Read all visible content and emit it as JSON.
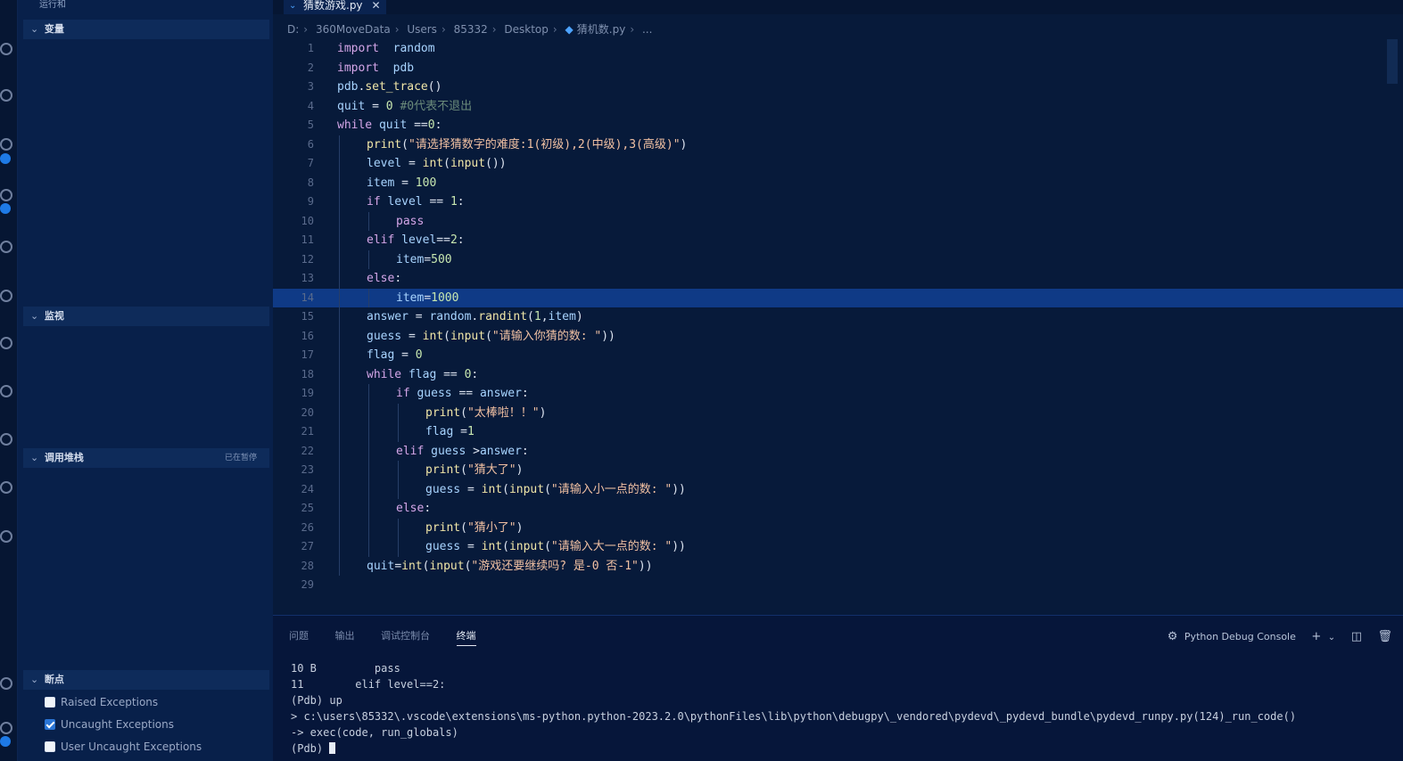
{
  "sidebar": {
    "top_label": "运行和",
    "sections": [
      {
        "title": "变量",
        "aux": ""
      },
      {
        "title": "监视",
        "aux": ""
      },
      {
        "title": "调用堆栈",
        "aux": "已在暂停"
      },
      {
        "title": "断点",
        "aux": ""
      }
    ],
    "exceptions": [
      {
        "label": "Raised Exceptions",
        "checked": false
      },
      {
        "label": "Uncaught Exceptions",
        "checked": true
      },
      {
        "label": "User Uncaught Exceptions",
        "checked": false
      }
    ]
  },
  "editor": {
    "tab_label": "猜数游戏.py",
    "breadcrumb": [
      "D:",
      "360MoveData",
      "Users",
      "85332",
      "Desktop",
      "猜机数.py",
      "..."
    ],
    "highlight_line": 14,
    "lines": [
      {
        "n": "1",
        "indent": 0,
        "tokens": [
          [
            "kw",
            "import"
          ],
          [
            "",
            "  "
          ],
          [
            "var",
            "random"
          ]
        ]
      },
      {
        "n": "2",
        "indent": 0,
        "tokens": [
          [
            "kw",
            "import"
          ],
          [
            "",
            "  "
          ],
          [
            "var",
            "pdb"
          ]
        ]
      },
      {
        "n": "3",
        "indent": 0,
        "tokens": [
          [
            "var",
            "pdb"
          ],
          [
            "",
            "."
          ],
          [
            "fn",
            "set_trace"
          ],
          [
            "",
            "()"
          ]
        ]
      },
      {
        "n": "4",
        "indent": 0,
        "tokens": [
          [
            "var",
            "quit"
          ],
          [
            "",
            " = "
          ],
          [
            "num",
            "0"
          ],
          [
            "",
            " "
          ],
          [
            "cm",
            "#0代表不退出"
          ]
        ]
      },
      {
        "n": "5",
        "indent": 0,
        "tokens": [
          [
            "kw",
            "while"
          ],
          [
            "",
            " "
          ],
          [
            "var",
            "quit"
          ],
          [
            "",
            " =="
          ],
          [
            "num",
            "0"
          ],
          [
            "",
            ":"
          ]
        ]
      },
      {
        "n": "6",
        "indent": 1,
        "tokens": [
          [
            "fn",
            "print"
          ],
          [
            "",
            "("
          ],
          [
            "str",
            "\"请选择猜数字的难度:1(初级),2(中级),3(高级)\""
          ],
          [
            "",
            ")"
          ]
        ]
      },
      {
        "n": "7",
        "indent": 1,
        "tokens": [
          [
            "var",
            "level"
          ],
          [
            "",
            " = "
          ],
          [
            "fn",
            "int"
          ],
          [
            "",
            "("
          ],
          [
            "fn",
            "input"
          ],
          [
            "",
            "())"
          ]
        ]
      },
      {
        "n": "8",
        "indent": 1,
        "tokens": [
          [
            "var",
            "item"
          ],
          [
            "",
            " = "
          ],
          [
            "num",
            "100"
          ]
        ]
      },
      {
        "n": "9",
        "indent": 1,
        "tokens": [
          [
            "kw",
            "if"
          ],
          [
            "",
            " "
          ],
          [
            "var",
            "level"
          ],
          [
            "",
            " == "
          ],
          [
            "num",
            "1"
          ],
          [
            "",
            ":"
          ]
        ]
      },
      {
        "n": "10",
        "indent": 2,
        "tokens": [
          [
            "kw",
            "pass"
          ]
        ]
      },
      {
        "n": "11",
        "indent": 1,
        "tokens": [
          [
            "kw",
            "elif"
          ],
          [
            "",
            " "
          ],
          [
            "var",
            "level"
          ],
          [
            "",
            "=="
          ],
          [
            "num",
            "2"
          ],
          [
            "",
            ":"
          ]
        ]
      },
      {
        "n": "12",
        "indent": 2,
        "tokens": [
          [
            "var",
            "item"
          ],
          [
            "",
            "="
          ],
          [
            "num",
            "500"
          ]
        ]
      },
      {
        "n": "13",
        "indent": 1,
        "tokens": [
          [
            "kw",
            "else"
          ],
          [
            "",
            ":"
          ]
        ]
      },
      {
        "n": "14",
        "indent": 2,
        "tokens": [
          [
            "var",
            "item"
          ],
          [
            "",
            "="
          ],
          [
            "num",
            "1000"
          ]
        ]
      },
      {
        "n": "15",
        "indent": 1,
        "tokens": [
          [
            "var",
            "answer"
          ],
          [
            "",
            " = "
          ],
          [
            "var",
            "random"
          ],
          [
            "",
            "."
          ],
          [
            "fn",
            "randint"
          ],
          [
            "",
            "("
          ],
          [
            "num",
            "1"
          ],
          [
            "",
            ","
          ],
          [
            "var",
            "item"
          ],
          [
            "",
            ")"
          ]
        ]
      },
      {
        "n": "16",
        "indent": 1,
        "tokens": [
          [
            "var",
            "guess"
          ],
          [
            "",
            " = "
          ],
          [
            "fn",
            "int"
          ],
          [
            "",
            "("
          ],
          [
            "fn",
            "input"
          ],
          [
            "",
            "("
          ],
          [
            "str",
            "\"请输入你猜的数: \""
          ],
          [
            "",
            "))"
          ]
        ]
      },
      {
        "n": "17",
        "indent": 1,
        "tokens": [
          [
            "var",
            "flag"
          ],
          [
            "",
            " = "
          ],
          [
            "num",
            "0"
          ]
        ]
      },
      {
        "n": "18",
        "indent": 1,
        "tokens": [
          [
            "kw",
            "while"
          ],
          [
            "",
            " "
          ],
          [
            "var",
            "flag"
          ],
          [
            "",
            " == "
          ],
          [
            "num",
            "0"
          ],
          [
            "",
            ":"
          ]
        ]
      },
      {
        "n": "19",
        "indent": 2,
        "tokens": [
          [
            "kw",
            "if"
          ],
          [
            "",
            " "
          ],
          [
            "var",
            "guess"
          ],
          [
            "",
            " == "
          ],
          [
            "var",
            "answer"
          ],
          [
            "",
            ":"
          ]
        ]
      },
      {
        "n": "20",
        "indent": 3,
        "tokens": [
          [
            "fn",
            "print"
          ],
          [
            "",
            "("
          ],
          [
            "str",
            "\"太棒啦！！\""
          ],
          [
            "",
            ")"
          ]
        ]
      },
      {
        "n": "21",
        "indent": 3,
        "tokens": [
          [
            "var",
            "flag"
          ],
          [
            "",
            " ="
          ],
          [
            "num",
            "1"
          ]
        ]
      },
      {
        "n": "22",
        "indent": 2,
        "tokens": [
          [
            "kw",
            "elif"
          ],
          [
            "",
            " "
          ],
          [
            "var",
            "guess"
          ],
          [
            "",
            " >"
          ],
          [
            "var",
            "answer"
          ],
          [
            "",
            ":"
          ]
        ]
      },
      {
        "n": "23",
        "indent": 3,
        "tokens": [
          [
            "fn",
            "print"
          ],
          [
            "",
            "("
          ],
          [
            "str",
            "\"猜大了\""
          ],
          [
            "",
            ")"
          ]
        ]
      },
      {
        "n": "24",
        "indent": 3,
        "tokens": [
          [
            "var",
            "guess"
          ],
          [
            "",
            " = "
          ],
          [
            "fn",
            "int"
          ],
          [
            "",
            "("
          ],
          [
            "fn",
            "input"
          ],
          [
            "",
            "("
          ],
          [
            "str",
            "\"请输入小一点的数: \""
          ],
          [
            "",
            "))"
          ]
        ]
      },
      {
        "n": "25",
        "indent": 2,
        "tokens": [
          [
            "kw",
            "else"
          ],
          [
            "",
            ":"
          ]
        ]
      },
      {
        "n": "26",
        "indent": 3,
        "tokens": [
          [
            "fn",
            "print"
          ],
          [
            "",
            "("
          ],
          [
            "str",
            "\"猜小了\""
          ],
          [
            "",
            ")"
          ]
        ]
      },
      {
        "n": "27",
        "indent": 3,
        "tokens": [
          [
            "var",
            "guess"
          ],
          [
            "",
            " = "
          ],
          [
            "fn",
            "int"
          ],
          [
            "",
            "("
          ],
          [
            "fn",
            "input"
          ],
          [
            "",
            "("
          ],
          [
            "str",
            "\"请输入大一点的数: \""
          ],
          [
            "",
            "))"
          ]
        ]
      },
      {
        "n": "28",
        "indent": 1,
        "tokens": [
          [
            "var",
            "quit"
          ],
          [
            "",
            "="
          ],
          [
            "fn",
            "int"
          ],
          [
            "",
            "("
          ],
          [
            "fn",
            "input"
          ],
          [
            "",
            "("
          ],
          [
            "str",
            "\"游戏还要继续吗? 是-0 否-1\""
          ],
          [
            "",
            "))"
          ]
        ]
      },
      {
        "n": "29",
        "indent": 0,
        "tokens": []
      }
    ]
  },
  "panel": {
    "tabs": [
      "问题",
      "输出",
      "调试控制台",
      "终端"
    ],
    "active_tab": 3,
    "console_name": "Python Debug Console",
    "terminal_lines": [
      "10 B         pass",
      "11        elif level==2:",
      "(Pdb) up",
      "> c:\\users\\85332\\.vscode\\extensions\\ms-python.python-2023.2.0\\pythonFiles\\lib\\python\\debugpy\\_vendored\\pydevd\\_pydevd_bundle\\pydevd_runpy.py(124)_run_code()",
      "-> exec(code, run_globals)",
      "(Pdb) "
    ]
  }
}
